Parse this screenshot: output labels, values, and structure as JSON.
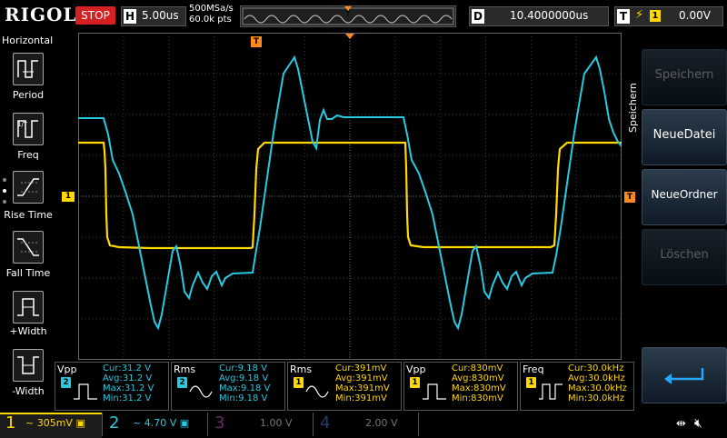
{
  "top": {
    "logo": "RIGOL",
    "run_state": "STOP",
    "h_tag": "H",
    "timebase": "5.00us",
    "sample_rate": "500MSa/s",
    "memory_depth": "60.0k pts",
    "d_tag": "D",
    "delay": "10.4000000us",
    "t_tag": "T",
    "trigger_source": "1",
    "trigger_level": "0.00V"
  },
  "left_menu": {
    "title": "Horizontal",
    "items": [
      {
        "label": "Period"
      },
      {
        "label": "Freq"
      },
      {
        "label": "Rise Time"
      },
      {
        "label": "Fall Time"
      },
      {
        "label": "+Width"
      },
      {
        "label": "-Width"
      }
    ]
  },
  "right_menu": {
    "title": "Speichern",
    "buttons": [
      {
        "label": "Speichern",
        "enabled": false
      },
      {
        "label": "NeueDatei",
        "enabled": true
      },
      {
        "label": "NeueOrdner",
        "enabled": true
      },
      {
        "label": "Löschen",
        "enabled": false
      }
    ]
  },
  "markers": {
    "ch1_ground": "1",
    "trigger_left": "T",
    "trigger_right": "T"
  },
  "measurements": [
    {
      "name": "Vpp",
      "channel": "2",
      "cur": "Cur:31.2 V",
      "avg": "Avg:31.2 V",
      "max": "Max:31.2 V",
      "min": "Min:31.2 V"
    },
    {
      "name": "Rms",
      "channel": "2",
      "cur": "Cur:9.18 V",
      "avg": "Avg:9.18 V",
      "max": "Max:9.18 V",
      "min": "Min:9.18 V"
    },
    {
      "name": "Rms",
      "channel": "1",
      "cur": "Cur:391mV",
      "avg": "Avg:391mV",
      "max": "Max:391mV",
      "min": "Min:391mV"
    },
    {
      "name": "Vpp",
      "channel": "1",
      "cur": "Cur:830mV",
      "avg": "Avg:830mV",
      "max": "Max:830mV",
      "min": "Min:830mV"
    },
    {
      "name": "Freq",
      "channel": "1",
      "cur": "Cur:30.0kHz",
      "avg": "Avg:30.0kHz",
      "max": "Max:30.0kHz",
      "min": "Min:30.0kHz"
    }
  ],
  "channels": [
    {
      "num": "1",
      "scale": "305mV",
      "color": "#ffd800",
      "active": true
    },
    {
      "num": "2",
      "scale": "4.70 V",
      "color": "#29c9e0",
      "active": true
    },
    {
      "num": "3",
      "scale": "1.00 V",
      "color": "#c030c0",
      "active": false
    },
    {
      "num": "4",
      "scale": "2.00 V",
      "color": "#3060d0",
      "active": false
    }
  ],
  "colors": {
    "ch1": "#ffd800",
    "ch2": "#29c9e0",
    "trigger": "#ff8a1a",
    "stop": "#d42020"
  }
}
